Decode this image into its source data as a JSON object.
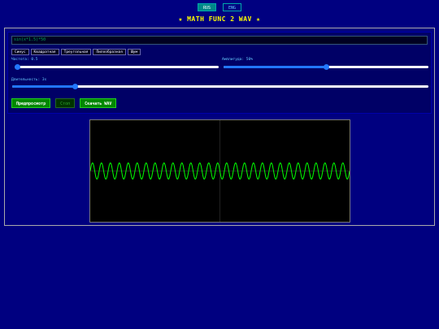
{
  "lang": {
    "ru": "RUS",
    "en": "ENG"
  },
  "title": "★ MATH FUNC 2 WAV ★",
  "formula": "sin(x*1.5)*50",
  "presets": [
    "Синус",
    "Квадратная",
    "Треугольная",
    "Пилообразная",
    "Шум"
  ],
  "frequency_label": "Частота: 0.5",
  "frequency_level": 0.01,
  "amplitude_label": "Амплитуда: 50%",
  "amplitude_level": 0.5,
  "duration_label": "Длительность: 3s",
  "duration_level": 0.15,
  "buttons": {
    "preview": "Предпросмотр",
    "stop": "Стоп",
    "download": "Скачать WAV"
  },
  "colors": {
    "background": "#000080",
    "title": "#ffff00",
    "wave": "#00ff00",
    "accent": "#2277ff"
  },
  "waveform": {
    "function": "sin",
    "cycles": 29,
    "amplitude_percent": 50
  }
}
